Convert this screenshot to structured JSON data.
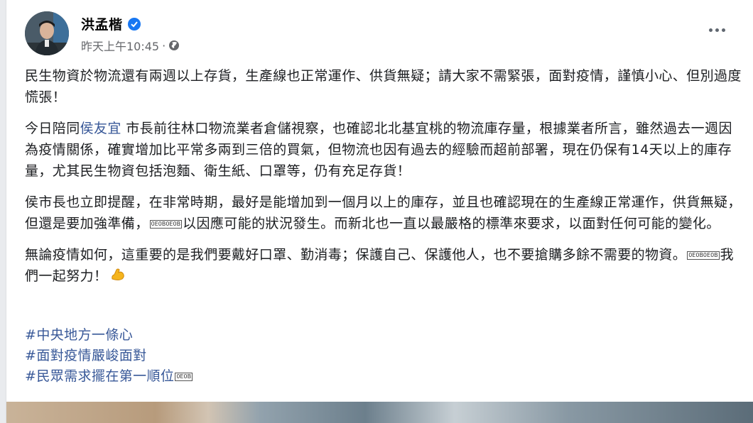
{
  "post": {
    "author": "洪孟楷",
    "time": "昨天上午10:45",
    "meta_sep": "·",
    "audience_icon": "globe-icon",
    "more_icon": "more-options-icon",
    "verified_icon": "verified-badge-icon",
    "para1": "民生物資於物流還有兩週以上存貨，生產線也正常運作、供貨無疑；請大家不需緊張，面對疫情，謹慎小心、但別過度慌張！",
    "para2": {
      "before": "今日陪同",
      "mention": "侯友宜",
      "after": " 市長前往林口物流業者倉儲視察，也確認北北基宜桃的物流庫存量，根據業者所言，雖然過去一週因為疫情關係，確實增加比平常多兩到三倍的買氣，但物流也因有過去的經驗而超前部署，現在仍保有14天以上的庫存量，尤其民生物資包括泡麵、衛生紙、口罩等，仍有充足存貨！"
    },
    "para3": {
      "before": "侯市長也立即提醒，在非常時期，最好是能增加到一個月以上的庫存，並且也確認現在的生產線正常運作，供貨無疑，但還是要加強準備，",
      "glyph": "0E0B0E0B",
      "after": "以因應可能的狀況發生。而新北也一直以最嚴格的標準來要求，以面對任何可能的變化。"
    },
    "para4": {
      "before": "無論疫情如何，這重要的是我們要戴好口罩、勤消毒；保護自己、保護他人，也不要搶購多餘不需要的物資。",
      "glyph": "0E0B0E0B",
      "after": "我們一起努力！",
      "emoji": "flexed-biceps-icon"
    },
    "tags": [
      "#中央地方一條心",
      "#面對疫情嚴峻面對",
      "#民眾需求擺在第一順位"
    ],
    "tag_glyph": "0E0B",
    "colors": {
      "link": "#385898",
      "badge": "#1877f2",
      "muted": "#65676b"
    }
  }
}
